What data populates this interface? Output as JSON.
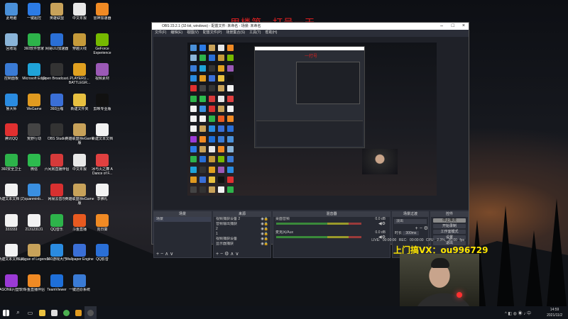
{
  "desktop": {
    "icons": [
      {
        "label": "此电脑",
        "color": "#4a90d9"
      },
      {
        "label": "一键超控",
        "color": "#2c7be5"
      },
      {
        "label": "英雄联盟",
        "color": "#c8a25a"
      },
      {
        "label": "中文年报",
        "color": "#e8e8e8"
      },
      {
        "label": "雷神加速器",
        "color": "#f08a24"
      },
      {
        "label": "回收站",
        "color": "#8ab4d8"
      },
      {
        "label": "360软件管家",
        "color": "#2db34a"
      },
      {
        "label": "网易UU加速器",
        "color": "#2a6fd6"
      },
      {
        "label": "穿越火线",
        "color": "#c59a3a"
      },
      {
        "label": "GeForce Experience",
        "color": "#76b900"
      },
      {
        "label": "控制面板",
        "color": "#3a7bd5"
      },
      {
        "label": "Microsoft Edge",
        "color": "#1fa3d9"
      },
      {
        "label": "Open Broadcast...",
        "color": "#333333"
      },
      {
        "label": "PLAYERU... BATTLEGR...",
        "color": "#e0a020"
      },
      {
        "label": "视频素材",
        "color": "#9b59b6"
      },
      {
        "label": "鲁大师",
        "color": "#2a8be0"
      },
      {
        "label": "WeGame",
        "color": "#e09a20"
      },
      {
        "label": "360压缩",
        "color": "#3a6fd6"
      },
      {
        "label": "新建文件夹",
        "color": "#e8c040"
      },
      {
        "label": "剪映专业版",
        "color": "#111111"
      },
      {
        "label": "腾讯QQ",
        "color": "#e03030"
      },
      {
        "label": "荒野行动",
        "color": "#444444"
      },
      {
        "label": "OBS Studio",
        "color": "#333333"
      },
      {
        "label": "英雄联盟WeGame版",
        "color": "#c8a25a"
      },
      {
        "label": "新建文本文档",
        "color": "#f2f2f2"
      },
      {
        "label": "360安全卫士",
        "color": "#2db34a"
      },
      {
        "label": "微信",
        "color": "#2dbb4e"
      },
      {
        "label": "六间房直播伴侣",
        "color": "#d63a3a"
      },
      {
        "label": "中文年报",
        "color": "#e8e8e8"
      },
      {
        "label": "冰与火之舞 A Dance of F...",
        "color": "#e04040"
      },
      {
        "label": "新建文本文档 (2)",
        "color": "#f2f2f2"
      },
      {
        "label": "quanminb...",
        "color": "#3a8fe0"
      },
      {
        "label": "网易云音乐",
        "color": "#d83030"
      },
      {
        "label": "英雄联盟WeGame版",
        "color": "#c8a25a"
      },
      {
        "label": "李佛礼",
        "color": "#f2f2f2"
      },
      {
        "label": "333333",
        "color": "#f2f2f2"
      },
      {
        "label": "213123131",
        "color": "#f2f2f2"
      },
      {
        "label": "QQ音乐",
        "color": "#2db34a"
      },
      {
        "label": "斗鱼直播",
        "color": "#e85a20"
      },
      {
        "label": "向日葵",
        "color": "#f08a24"
      },
      {
        "label": "新建文本文档 (3)",
        "color": "#f2f2f2"
      },
      {
        "label": "League of Legends",
        "color": "#c8a25a"
      },
      {
        "label": "360游戏大厅",
        "color": "#2a8be0"
      },
      {
        "label": "Wallpaper Engine",
        "color": "#3a6fd6"
      },
      {
        "label": "QQ影音",
        "color": "#2a6fd6"
      },
      {
        "label": "IPASONE闪登软件",
        "color": "#9b3ad6"
      },
      {
        "label": "斗鱼直播伴侣",
        "color": "#f08a24"
      },
      {
        "label": "TeamViewer",
        "color": "#1e6fd9"
      },
      {
        "label": "一键还原系统",
        "color": "#3a7bd5"
      }
    ]
  },
  "obs": {
    "title": "OBS 23.2.1 (32-bit, windows) - 配置文件: 未命名 - 场景: 未命名",
    "menu": [
      "文件(F)",
      "编辑(E)",
      "视图(V)",
      "配置文件(P)",
      "场景集合(S)",
      "工具(T)",
      "帮助(H)"
    ],
    "docks": {
      "scenes": {
        "title": "场景",
        "items": [
          "场景"
        ]
      },
      "sources": {
        "title": "来源",
        "items": [
          "视频捕获设备 2",
          "音频输出捕获",
          "2",
          "1",
          "视频捕获设备",
          "显示器捕获"
        ]
      },
      "mixer": {
        "title": "混音器",
        "tracks": [
          {
            "name": "桌面音频",
            "db": "0.0 dB"
          },
          {
            "name": "麦克风/Aux",
            "db": "0.0 dB"
          }
        ]
      },
      "transitions": {
        "title": "场景过渡",
        "type": "淡出",
        "duration_label": "时长",
        "duration": "300ms"
      },
      "controls": {
        "title": "控件",
        "buttons": [
          "停止推流",
          "开始录制",
          "工作室模式",
          "设置",
          "退出"
        ]
      }
    },
    "status": {
      "live": "LIVE: 00:00:00",
      "rec": "REC: 00:00:00",
      "cpu": "CPU: 2.3%, 30.00 fps"
    }
  },
  "overlays": {
    "title_text": "用楼第一打号一天",
    "promo_text": "上门搞VX：ou996729",
    "nested_title": "一打号"
  },
  "taskbar": {
    "time": "14:59",
    "date": "2021/11/2"
  },
  "colors": {
    "obs_bg": "#2b2e38",
    "overlay_red": "#e02020",
    "overlay_yellow": "#ffe600"
  }
}
